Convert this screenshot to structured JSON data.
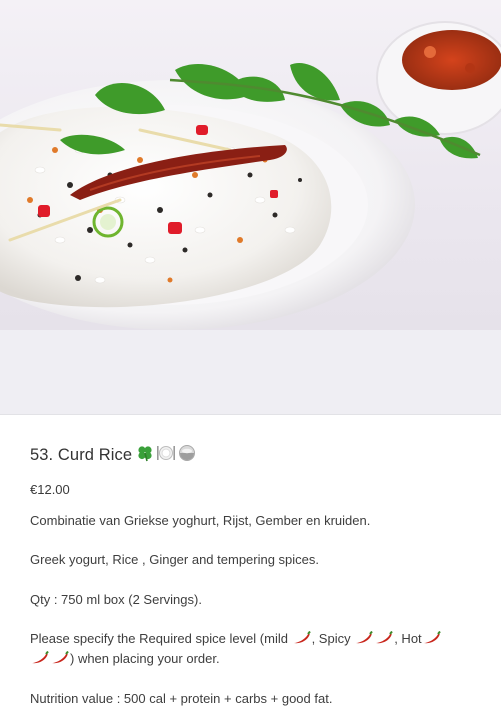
{
  "product": {
    "title": "53. Curd Rice",
    "title_icons": [
      "clover-icon",
      "plate-cutlery-icon",
      "bowl-icon"
    ],
    "price": "€12.00",
    "description_nl": "Combinatie van Griekse yoghurt, Rijst, Gember en kruiden.",
    "description_en": "Greek yogurt, Rice , Ginger and tempering spices.",
    "quantity": "Qty : 750 ml box (2 Servings).",
    "spice_text": {
      "part1": "Please specify the Required spice level (mild ",
      "part2": ", Spicy ",
      "part3": ", Hot",
      "part4": ") when placing your order."
    },
    "nutrition": "Nutrition value : 500 cal + protein + carbs + good fat."
  },
  "colors": {
    "chili_red": "#c8261c",
    "chili_stem": "#3d8a2a",
    "clover_green": "#3aa03a",
    "divider": "#e2e2e6"
  }
}
